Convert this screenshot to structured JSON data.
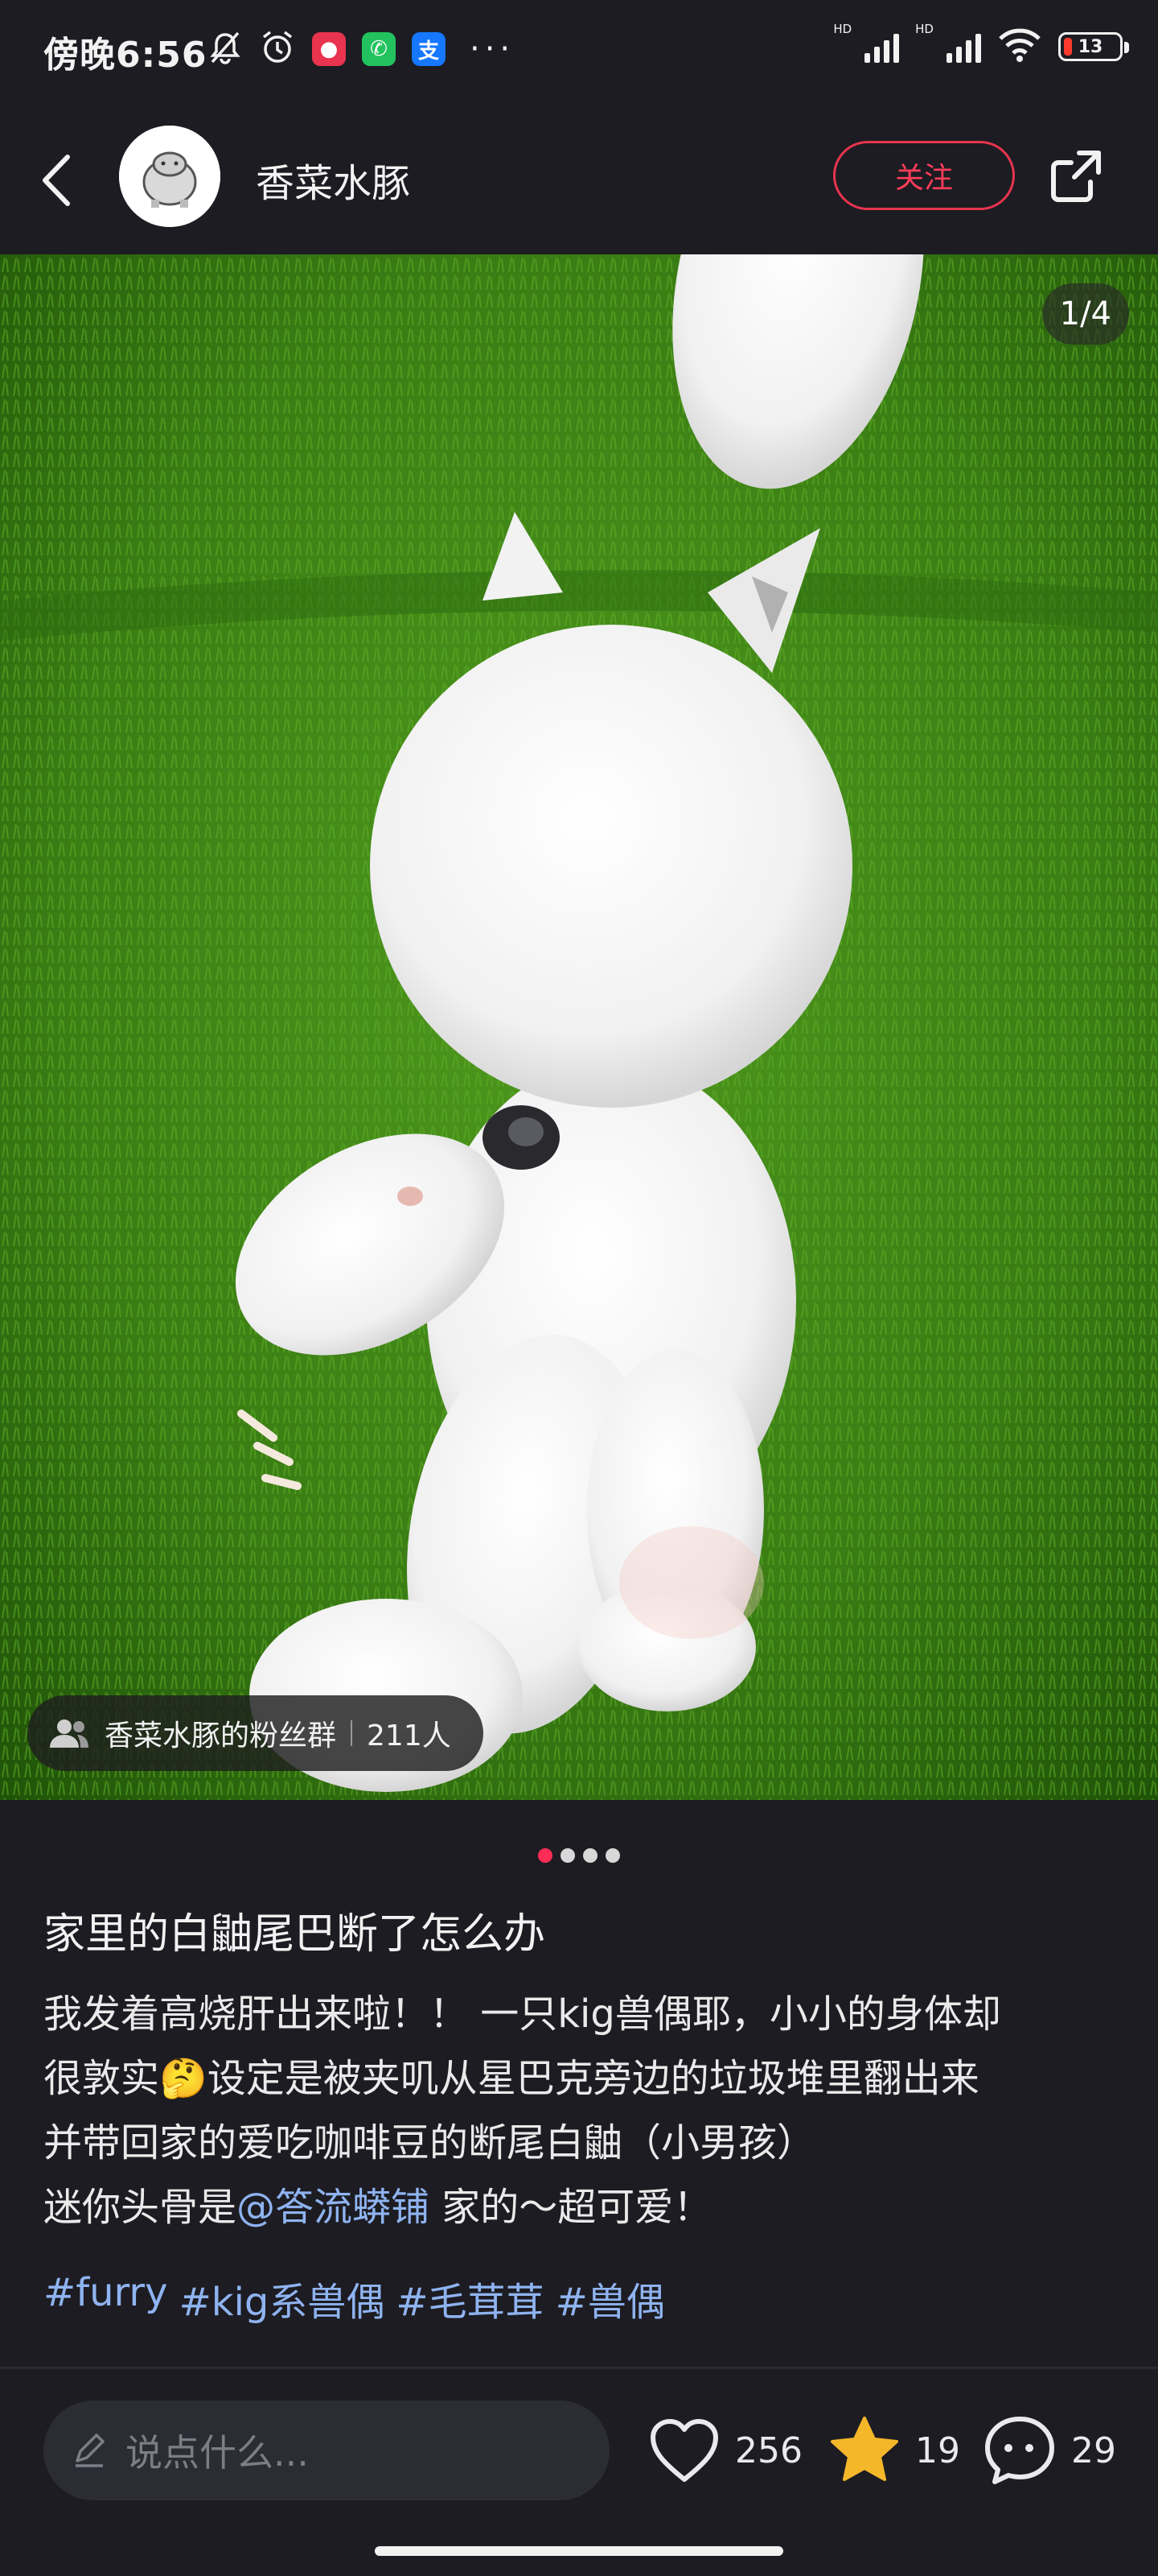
{
  "status_bar": {
    "time": "傍晚6:56",
    "battery_level": "13",
    "icons": [
      "mute-bell-icon",
      "alarm-icon",
      "red-app-icon",
      "wechat-icon",
      "alipay-icon",
      "more-dots-icon",
      "signal-hd-icon",
      "signal-hd-icon",
      "wifi-icon",
      "battery-icon"
    ]
  },
  "header": {
    "author_name": "香菜水豚",
    "follow_label": "关注"
  },
  "photo": {
    "counter": "1/4",
    "fan_group_name": "香菜水豚的粉丝群",
    "fan_group_count": "211人"
  },
  "post": {
    "title": "家里的白鼬尾巴断了怎么办",
    "body_line1": "我发着高烧肝出来啦！！ 一只kig兽偶耶，小小的身体却",
    "body_line2": "很敦实🤔设定是被夹叽从星巴克旁边的垃圾堆里翻出来",
    "body_line3": "并带回家的爱吃咖啡豆的断尾白鼬（小男孩）",
    "body_line4_prefix": "迷你头骨是",
    "body_mention": "@答流蟒铺",
    "body_line4_suffix": " 家的～超可爱！",
    "tags": [
      "#furry",
      "#kig系兽偶",
      "#毛茸茸",
      "#兽偶"
    ]
  },
  "bottom_bar": {
    "comment_placeholder": "说点什么...",
    "likes": "256",
    "favorites": "19",
    "comments": "29"
  },
  "colors": {
    "accent": "#ff2d55",
    "background": "#1c1c22",
    "link": "#8fb3f0",
    "star": "#f5b72a"
  },
  "carousel": {
    "total": 4,
    "current": 1
  }
}
